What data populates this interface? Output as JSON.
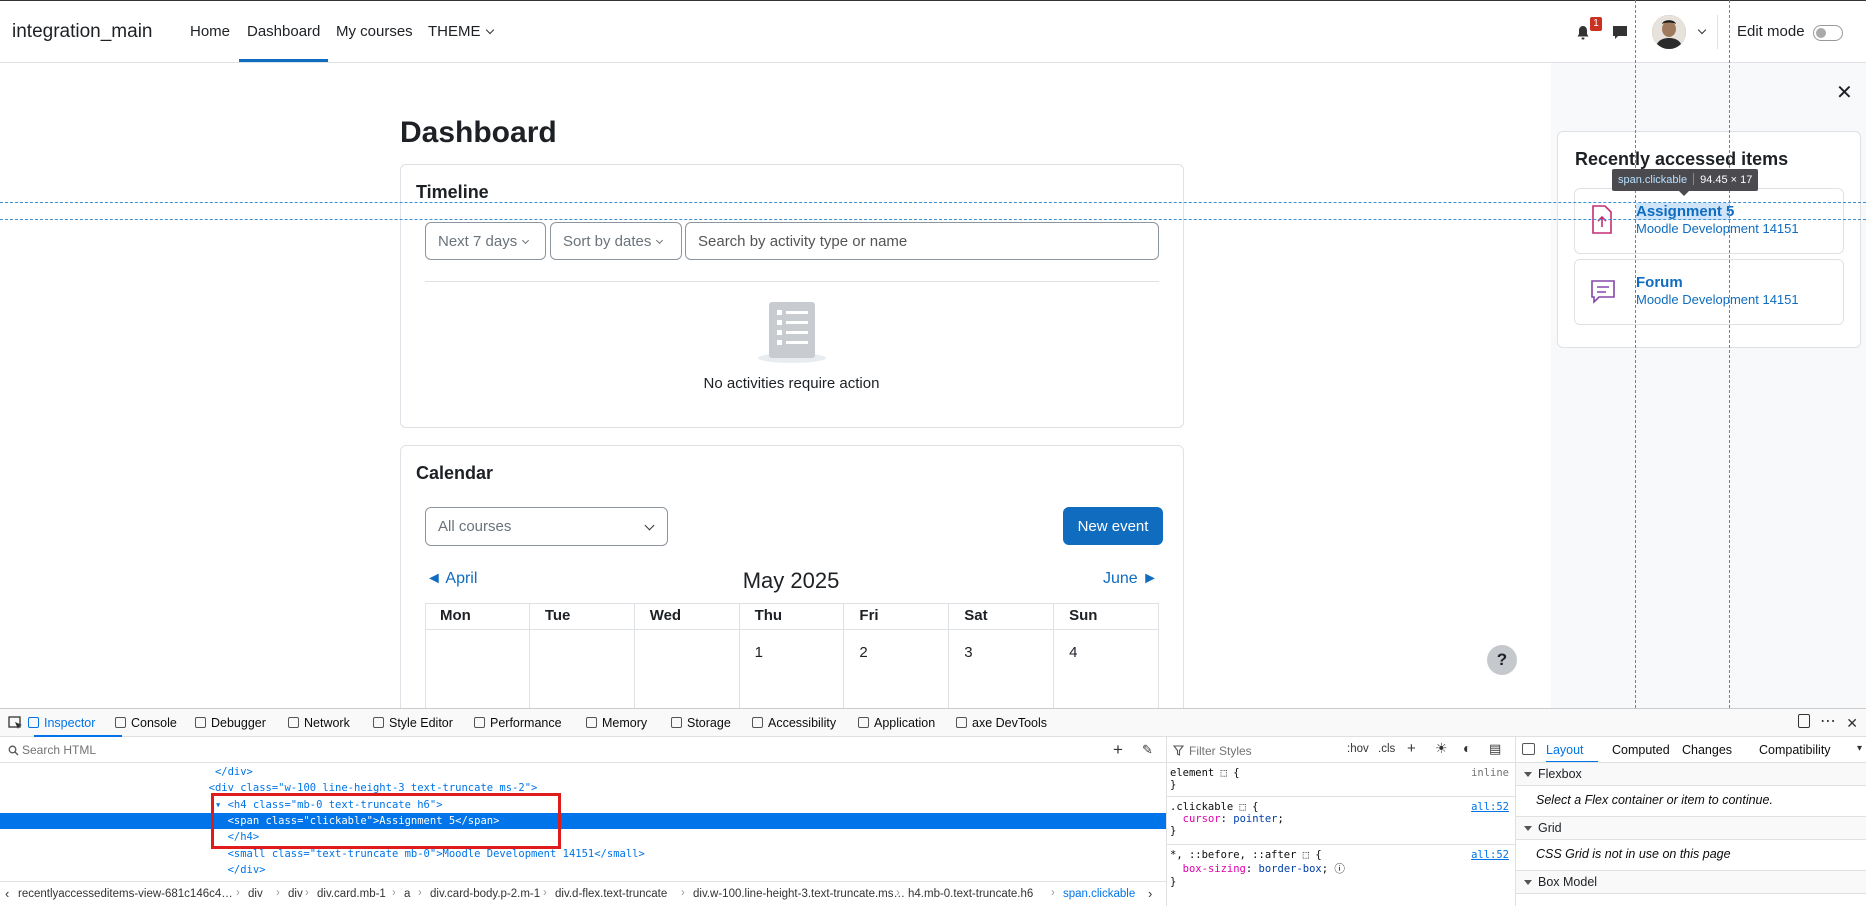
{
  "navbar": {
    "brand": "integration_main",
    "links": [
      "Home",
      "Dashboard",
      "My courses",
      "THEME"
    ],
    "notification_count": "1",
    "edit_mode_label": "Edit mode"
  },
  "page": {
    "title": "Dashboard"
  },
  "timeline": {
    "title": "Timeline",
    "filter_label": "Next 7 days",
    "sort_label": "Sort by dates",
    "search_placeholder": "Search by activity type or name",
    "empty_message": "No activities require action"
  },
  "calendar": {
    "title": "Calendar",
    "course_select": "All courses",
    "new_event_label": "New event",
    "prev_month": "◄  April",
    "current_month": "May 2025",
    "next_month": "June  ►",
    "weekdays": [
      "Mon",
      "Tue",
      "Wed",
      "Thu",
      "Fri",
      "Sat",
      "Sun"
    ],
    "first_row": [
      "",
      "",
      "",
      "1",
      "2",
      "3",
      "4"
    ]
  },
  "help_label": "?",
  "drawer": {
    "close_label": "✕",
    "title": "Recently accessed items",
    "items": [
      {
        "name": "Assignment 5",
        "course": "Moodle Development 14151",
        "icon": "assignment-icon"
      },
      {
        "name": "Forum",
        "course": "Moodle Development 14151",
        "icon": "forum-icon"
      }
    ]
  },
  "inspector_tooltip": {
    "selector": "span.clickable",
    "size": "94.45 × 17"
  },
  "devtools": {
    "tabs": [
      "Inspector",
      "Console",
      "Debugger",
      "Network",
      "Style Editor",
      "Performance",
      "Memory",
      "Storage",
      "Accessibility",
      "Application",
      "axe DevTools"
    ],
    "search_placeholder": "Search HTML",
    "markup_lines": [
      {
        "indent": "            ",
        "text": "</div>"
      },
      {
        "indent": "           ",
        "text": "<div class=\"w-100 line-height-3 text-truncate ms-2\">"
      },
      {
        "indent": "            ",
        "text": "▾ <h4 class=\"mb-0 text-truncate h6\">"
      },
      {
        "indent": "              ",
        "text": "<span class=\"clickable\">Assignment 5</span>"
      },
      {
        "indent": "              ",
        "text": "</h4>"
      },
      {
        "indent": "              ",
        "text": "<small class=\"text-truncate mb-0\">Moodle Development 14151</small>"
      },
      {
        "indent": "              ",
        "text": "</div>"
      }
    ],
    "breadcrumbs": [
      "recentlyaccesseditems-view-681c146c4…",
      "div",
      "div",
      "div.card.mb-1",
      "a",
      "div.card-body.p-2.m-1",
      "div.d-flex.text-truncate",
      "div.w-100.line-height-3.text-truncate.ms…",
      "h4.mb-0.text-truncate.h6",
      "span.clickable"
    ],
    "rules": {
      "filter_placeholder": "Filter Styles",
      "hov": ":hov",
      "cls": ".cls",
      "element_selector": "element",
      "element_display": "inline",
      "rule1_selector": ".clickable",
      "rule1_prop": "cursor",
      "rule1_value": "pointer",
      "rule1_src": "all:52",
      "rule2_selector": "*, ::before, ::after",
      "rule2_prop": "box-sizing",
      "rule2_value": "border-box",
      "rule2_src": "all:52"
    },
    "layout": {
      "tabs": [
        "Layout",
        "Computed",
        "Changes",
        "Compatibility"
      ],
      "flexbox_title": "Flexbox",
      "flexbox_msg": "Select a Flex container or item to continue.",
      "grid_title": "Grid",
      "grid_msg": "CSS Grid is not in use on this page",
      "boxmodel_title": "Box Model"
    }
  }
}
